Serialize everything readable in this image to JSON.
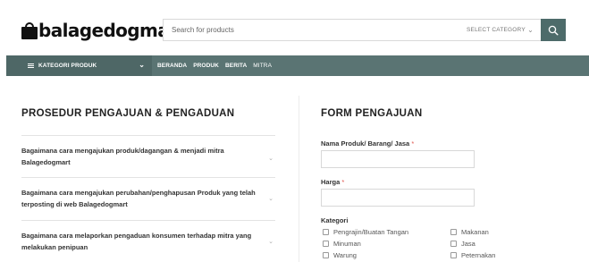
{
  "header": {
    "logo_text": "balagedogmart",
    "search_placeholder": "Search for products",
    "category_select": "SELECT CATEGORY"
  },
  "nav": {
    "kategori_label": "KATEGORI PRODUK",
    "items": [
      {
        "label": "BERANDA"
      },
      {
        "label": "PRODUK"
      },
      {
        "label": "BERITA"
      },
      {
        "label": "MITRA"
      }
    ]
  },
  "left": {
    "title": "PROSEDUR PENGAJUAN & PENGADUAN",
    "faqs": [
      {
        "question": "Bagaimana cara mengajukan produk/dagangan & menjadi mitra Balagedogmart"
      },
      {
        "question": "Bagaimana cara mengajukan perubahan/penghapusan Produk yang telah terposting di web Balagedogmart"
      },
      {
        "question": "Bagaimana cara melaporkan pengaduan konsumen terhadap mitra yang melakukan penipuan"
      }
    ]
  },
  "form": {
    "title": "FORM PENGAJUAN",
    "fields": [
      {
        "label": "Nama Produk/ Barang/ Jasa",
        "required_mark": "*"
      },
      {
        "label": "Harga",
        "required_mark": "*"
      }
    ],
    "kategori_label": "Kategori",
    "checkboxes": [
      {
        "label": "Pengrajin/Buatan Tangan"
      },
      {
        "label": "Makanan"
      },
      {
        "label": "Minuman"
      },
      {
        "label": "Jasa"
      },
      {
        "label": "Warung"
      },
      {
        "label": "Peternakan"
      }
    ]
  },
  "colors": {
    "nav_bg": "#5a7473",
    "kategori_bg": "#4e6766",
    "search_button": "#4d6b6a",
    "required": "#e0524a"
  },
  "icons": {
    "logo": "shopping-bag-icon",
    "search": "search-icon",
    "menu": "hamburger-icon",
    "expand": "chevron-down-icon"
  }
}
